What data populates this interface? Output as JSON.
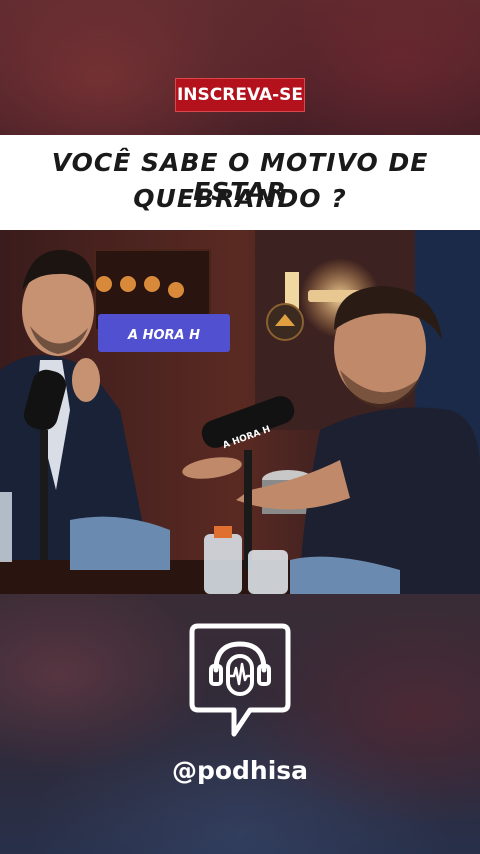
{
  "badge": {
    "label": "INSCREVA-SE",
    "color": "#b3121c"
  },
  "headline": {
    "line1": "VOCÊ SABE O MOTIVO DE ESTAR",
    "line2": "QUEBRANDO ?"
  },
  "video": {
    "studio_sign": "A HORA H",
    "mic_label": "A HORA H"
  },
  "logo": {
    "icon": "podcast-headphones-speech-icon"
  },
  "handle": {
    "text": "@podhisa"
  }
}
